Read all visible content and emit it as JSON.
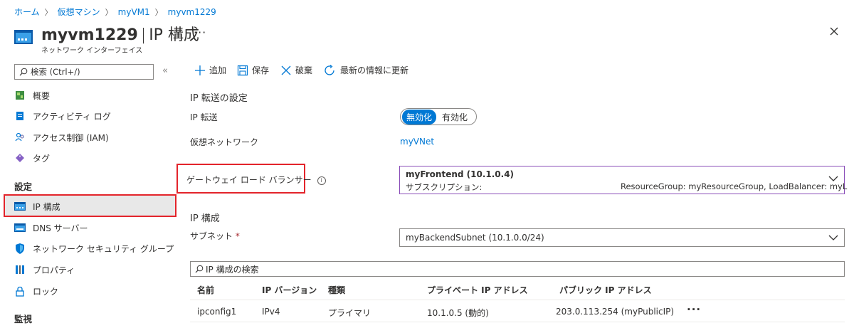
{
  "breadcrumb": [
    "ホーム",
    "仮想マシン",
    "myVM1",
    "myvm1229"
  ],
  "header": {
    "title": "myvm1229",
    "title_suffix": "IP 構成",
    "subtitle": "ネットワーク インターフェイス",
    "more": "···"
  },
  "sidebar": {
    "search_placeholder": "検索 (Ctrl+/)",
    "collapse": "«",
    "items_top": [
      {
        "label": "概要",
        "icon": "overview-icon"
      },
      {
        "label": "アクティビティ ログ",
        "icon": "activity-log-icon"
      },
      {
        "label": "アクセス制御 (IAM)",
        "icon": "iam-icon"
      },
      {
        "label": "タグ",
        "icon": "tag-icon"
      }
    ],
    "section_settings": "設定",
    "items_settings": [
      {
        "label": "IP 構成",
        "icon": "ip-config-icon",
        "selected": true
      },
      {
        "label": "DNS サーバー",
        "icon": "dns-icon"
      },
      {
        "label": "ネットワーク セキュリティ グループ",
        "icon": "nsg-shield-icon"
      },
      {
        "label": "プロパティ",
        "icon": "properties-icon"
      },
      {
        "label": "ロック",
        "icon": "lock-icon"
      }
    ],
    "section_monitoring": "監視"
  },
  "commands": {
    "add": "追加",
    "save": "保存",
    "discard": "破棄",
    "refresh": "最新の情報に更新"
  },
  "ip_forwarding": {
    "section": "IP 転送の設定",
    "label": "IP 転送",
    "toggle_on": "無効化",
    "toggle_off": "有効化",
    "vnet_label": "仮想ネットワーク",
    "vnet_value": "myVNet"
  },
  "gateway_lb": {
    "label": "ゲートウェイ ロード バランサー",
    "selected_main": "myFrontend (10.1.0.4)",
    "selected_sub": "サブスクリプション:",
    "selected_rg": "ResourceGroup: myResourceGroup, LoadBalancer: myL"
  },
  "ip_config": {
    "section": "IP 構成",
    "subnet_label": "サブネット",
    "required_mark": "*",
    "subnet_value": "myBackendSubnet (10.1.0.0/24)",
    "filter_placeholder": "IP 構成の検索",
    "columns": [
      "名前",
      "IP バージョン",
      "種類",
      "プライベート IP アドレス",
      "パブリック IP アドレス"
    ],
    "rows": [
      [
        "ipconfig1",
        "IPv4",
        "プライマリ",
        "10.1.0.5 (動的)",
        "203.0.113.254 (myPublicIP)"
      ]
    ],
    "row_menu": "···"
  },
  "colors": {
    "accent": "#0078d4",
    "highlight_border": "#e3242b",
    "dropdown_border": "#8a4db8"
  }
}
